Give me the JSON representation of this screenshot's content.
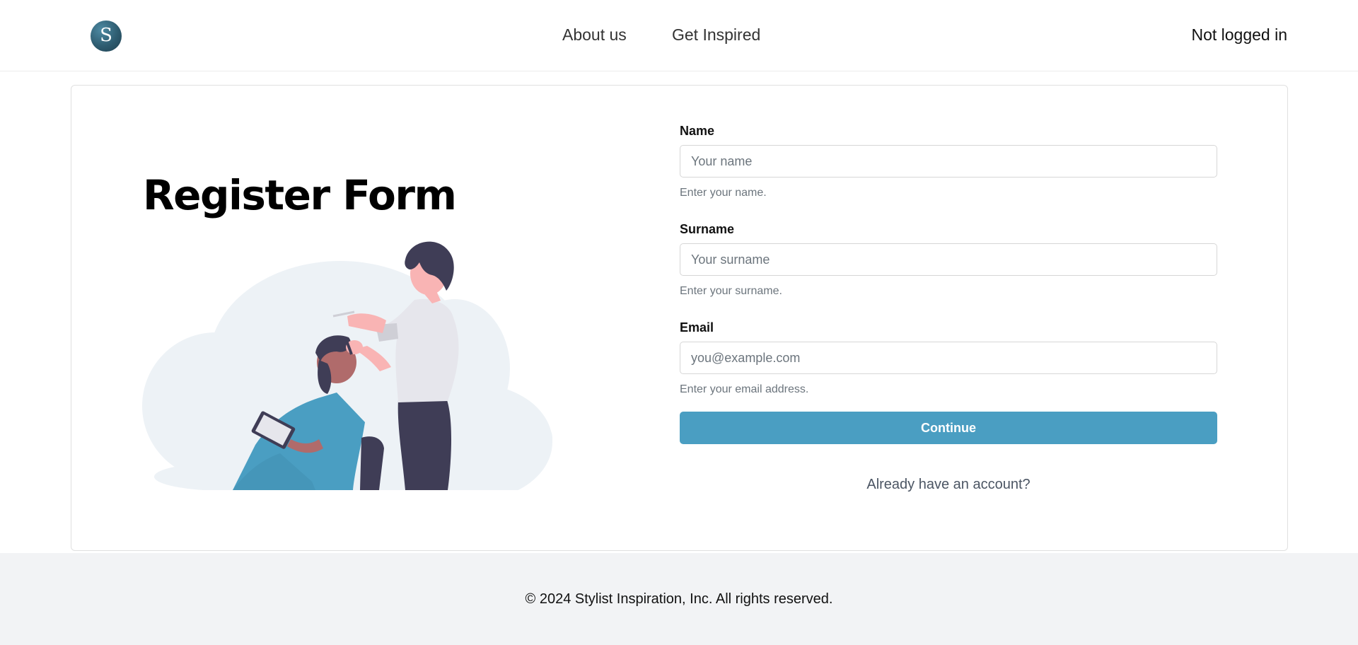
{
  "header": {
    "logo_letter": "S",
    "nav": {
      "about": "About us",
      "inspired": "Get Inspired"
    },
    "login_status": "Not logged in"
  },
  "main": {
    "title": "Register Form",
    "illustration": "barber-cutting-hair-illustration",
    "form": {
      "name": {
        "label": "Name",
        "placeholder": "Your name",
        "value": "",
        "help": "Enter your name."
      },
      "surname": {
        "label": "Surname",
        "placeholder": "Your surname",
        "value": "",
        "help": "Enter your surname."
      },
      "email": {
        "label": "Email",
        "placeholder": "you@example.com",
        "value": "",
        "help": "Enter your email address."
      },
      "submit_label": "Continue",
      "login_link": "Already have an account?"
    }
  },
  "footer": {
    "copyright": "© 2024 Stylist Inspiration, Inc. All rights reserved."
  },
  "colors": {
    "accent": "#4a9ec2",
    "footer_bg": "#f2f3f5",
    "logo": "#2e5c70"
  }
}
